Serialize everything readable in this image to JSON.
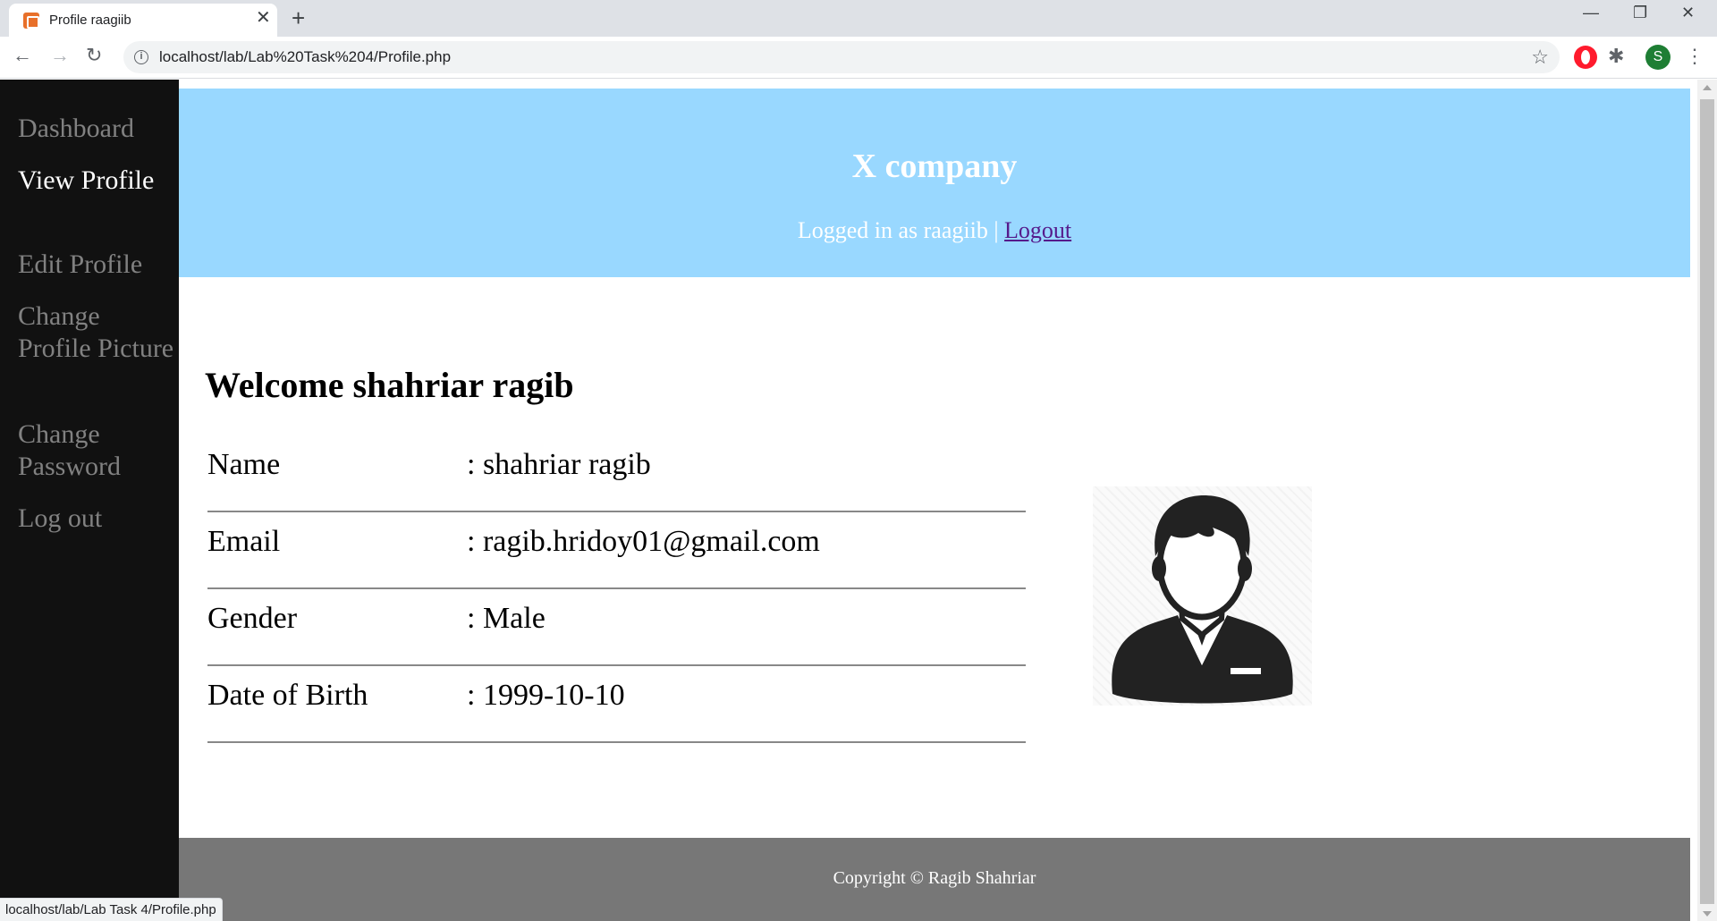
{
  "browser": {
    "tab_title": "Profile raagiib",
    "url": "localhost/lab/Lab%20Task%204/Profile.php",
    "profile_initial": "S",
    "status_url": "localhost/lab/Lab Task 4/Profile.php"
  },
  "sidebar": {
    "items": [
      {
        "label": "Dashboard"
      },
      {
        "label": "View Profile"
      },
      {
        "label": "Edit Profile"
      },
      {
        "label": "Change Profile Picture"
      },
      {
        "label": "Change Password"
      },
      {
        "label": "Log out"
      }
    ]
  },
  "header": {
    "company": "X company",
    "logged_in_text": "Logged in as raagiib | ",
    "logout_label": "Logout"
  },
  "main": {
    "welcome": "Welcome shahriar ragib",
    "rows": [
      {
        "label": "Name",
        "value": ": shahriar ragib"
      },
      {
        "label": "Email",
        "value": ": ragib.hridoy01@gmail.com"
      },
      {
        "label": "Gender",
        "value": ": Male"
      },
      {
        "label": "Date of Birth",
        "value": ": 1999-10-10"
      }
    ]
  },
  "footer": {
    "copyright": "Copyright © Ragib Shahriar"
  },
  "colors": {
    "header_bg": "#99d8ff",
    "sidebar_bg": "#111111",
    "footer_bg": "#777777"
  }
}
